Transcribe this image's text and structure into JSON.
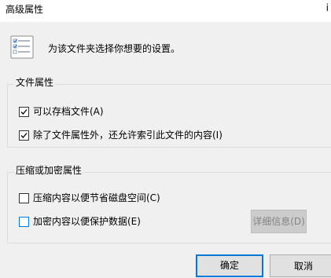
{
  "window": {
    "title": "高级属性",
    "close_fragment": "i"
  },
  "header": {
    "icon": "properties-checklist-icon",
    "text": "为该文件夹选择你想要的设置。"
  },
  "file_attributes": {
    "group_label": "文件属性",
    "archive_label": "可以存档文件(A)",
    "archive_checked": true,
    "index_label": "除了文件属性外，还允许索引此文件的内容(I)",
    "index_checked": true
  },
  "compress_encrypt": {
    "group_label": "压缩或加密属性",
    "compress_label": "压缩内容以便节省磁盘空间(C)",
    "compress_checked": false,
    "encrypt_label": "加密内容以便保护数据(E)",
    "encrypt_checked": false,
    "details_button": "详细信息(D)",
    "details_enabled": false
  },
  "buttons": {
    "ok": "确定",
    "cancel": "取消"
  },
  "colors": {
    "accent": "#0078d7",
    "dialog_background": "#f0f0f0",
    "disabled_text": "#838383"
  }
}
